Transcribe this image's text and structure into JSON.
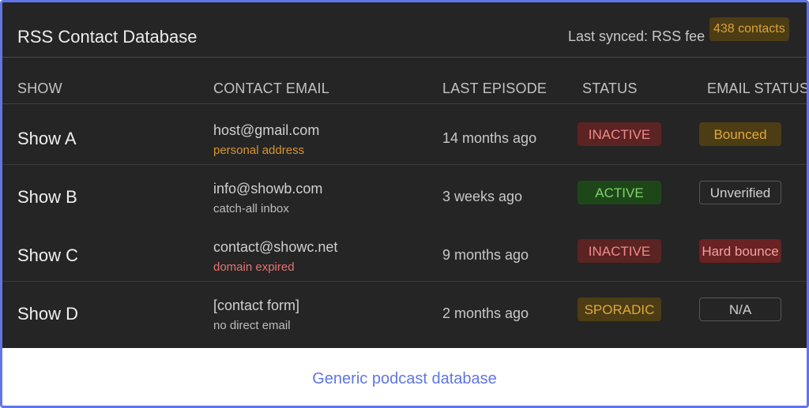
{
  "header": {
    "title": "RSS Contact Database",
    "synced_text": "Last synced: RSS fee",
    "count_badge": "438 contacts"
  },
  "columns": [
    "SHOW",
    "CONTACT EMAIL",
    "LAST EPISODE",
    "STATUS",
    "EMAIL STATUS"
  ],
  "rows": [
    {
      "show": "Show A",
      "email": "host@gmail.com",
      "note": "personal address",
      "note_color": "#d9962e",
      "last_episode": "14 months ago",
      "status": "INACTIVE",
      "status_colors": {
        "bg": "#5c2323",
        "fg": "#f08a8a"
      },
      "email_status": "Bounced",
      "email_status_colors": {
        "bg": "#4d3d15",
        "fg": "#e0a83c",
        "border": "#4d3d15"
      }
    },
    {
      "show": "Show B",
      "email": "info@showb.com",
      "note": "catch-all inbox",
      "note_color": "#bdbdbd",
      "last_episode": "3 weeks ago",
      "status": "ACTIVE",
      "status_colors": {
        "bg": "#1e4719",
        "fg": "#7fd36b"
      },
      "email_status": "Unverified",
      "email_status_colors": {
        "bg": "transparent",
        "fg": "#cfcfcf",
        "border": "#555555"
      }
    },
    {
      "show": "Show C",
      "email": "contact@showc.net",
      "note": "domain expired",
      "note_color": "#e57373",
      "last_episode": "9 months ago",
      "status": "INACTIVE",
      "status_colors": {
        "bg": "#5c2323",
        "fg": "#f08a8a"
      },
      "email_status": "Hard bounce",
      "email_status_colors": {
        "bg": "#6a2222",
        "fg": "#f2a0a0",
        "border": "#6a2222"
      }
    },
    {
      "show": "Show D",
      "email": "[contact form]",
      "note": "no direct email",
      "note_color": "#bdbdbd",
      "last_episode": "2 months ago",
      "status": "SPORADIC",
      "status_colors": {
        "bg": "#4d3d15",
        "fg": "#e0a83c"
      },
      "email_status": "N/A",
      "email_status_colors": {
        "bg": "transparent",
        "fg": "#cfcfcf",
        "border": "#555555"
      }
    }
  ],
  "footer": {
    "caption": "Generic podcast database"
  }
}
